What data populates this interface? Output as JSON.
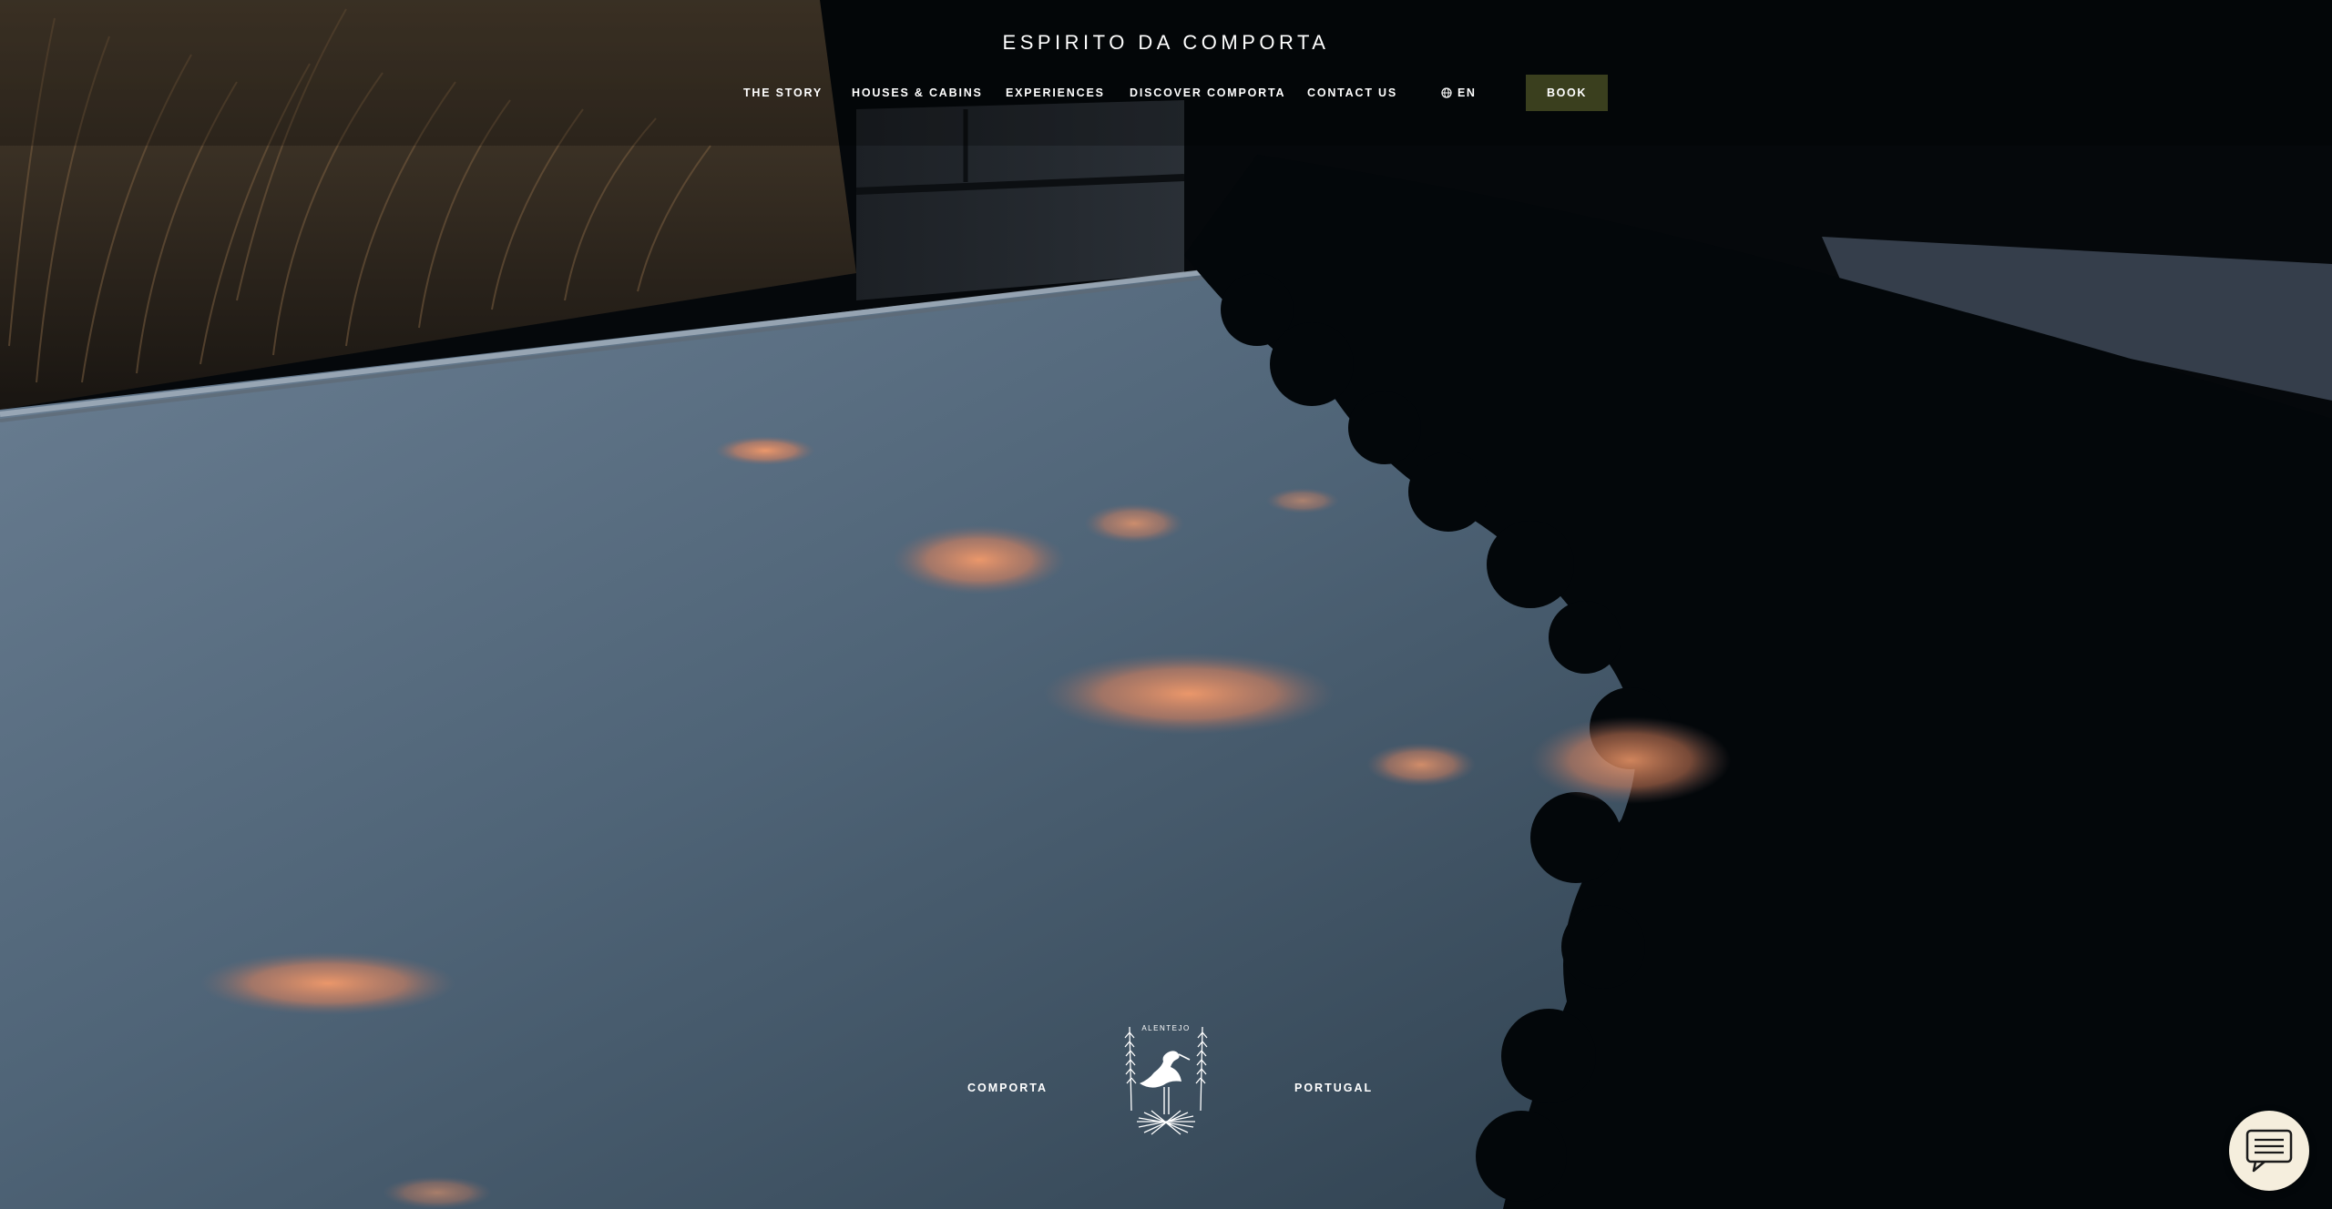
{
  "header": {
    "site_title": "ESPIRITO DA COMPORTA"
  },
  "nav": {
    "items": [
      {
        "label": "THE STORY"
      },
      {
        "label": "HOUSES & CABINS"
      },
      {
        "label": "EXPERIENCES"
      },
      {
        "label": "DISCOVER COMPORTA"
      },
      {
        "label": "CONTACT US"
      }
    ],
    "language": {
      "label": "EN",
      "icon": "globe-icon"
    },
    "book_label": "BOOK"
  },
  "emblem": {
    "region": "ALENTEJO",
    "left_label": "COMPORTA",
    "right_label": "PORTUGAL",
    "icon": "stork-crest-icon"
  },
  "chat": {
    "icon": "chat-icon"
  },
  "colors": {
    "book_button": "#3a3f1e",
    "chat_button": "#f5eedd",
    "text": "#ffffff"
  }
}
